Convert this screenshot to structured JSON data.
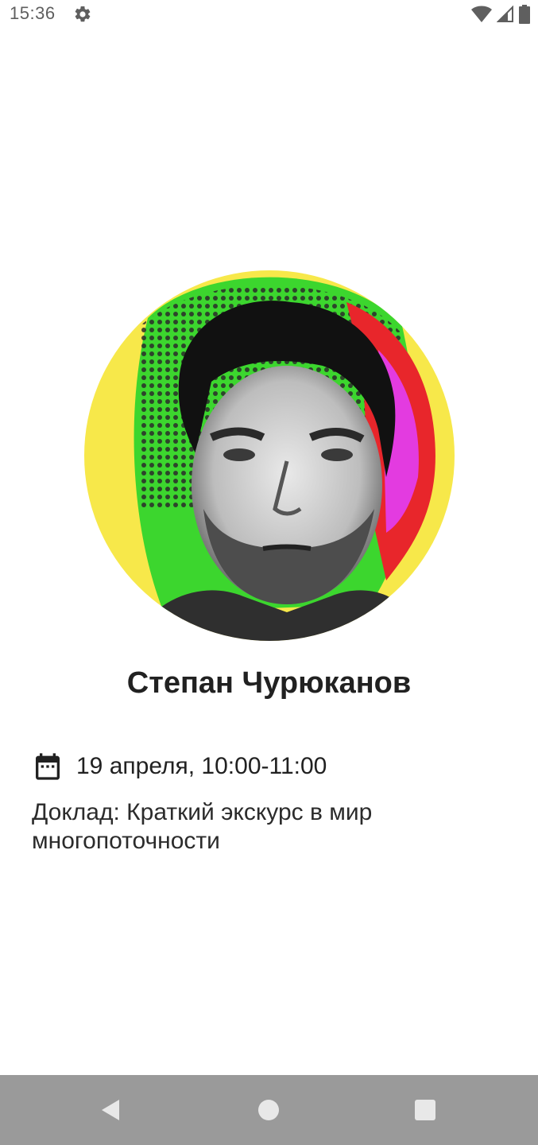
{
  "status_bar": {
    "time": "15:36",
    "icons": [
      "gear-icon",
      "wifi-icon",
      "signal-icon",
      "battery-icon"
    ]
  },
  "speaker": {
    "name": "Степан Чурюканов",
    "photo_background_colors": [
      "#f7e84a",
      "#3cd62e",
      "#e8262b",
      "#e33be0"
    ]
  },
  "session": {
    "date_time": "19 апреля, 10:00-11:00",
    "talk": "Доклад: Краткий экскурс в мир многопоточности",
    "date_icon": "calendar-icon"
  },
  "nav_bar": {
    "buttons": [
      "back-icon",
      "home-icon",
      "recents-icon"
    ],
    "color": "#9a9a9a"
  }
}
